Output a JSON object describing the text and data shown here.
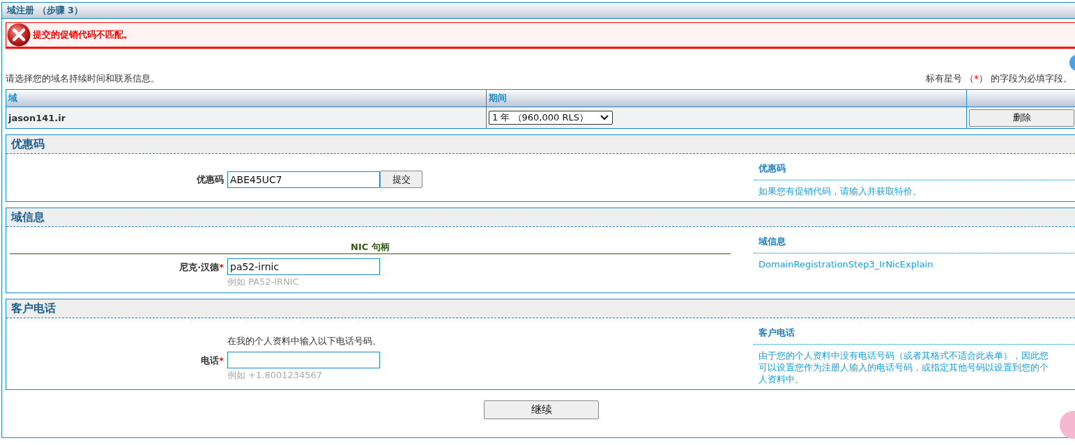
{
  "title": "域注册 （步骤 3）",
  "error": {
    "message": "提交的促销代码不匹配。"
  },
  "intro": "请选择您的域名持续时间和联系信息。",
  "required_note": {
    "before": "标有星号 （",
    "asterisk": "*",
    "after": "） 的字段为必填字段。"
  },
  "domain_table": {
    "columns": [
      "域",
      "期间"
    ],
    "rows": [
      {
        "domain": "jason141.ir",
        "period": "1 年 （960,000 RLS）",
        "action": "删除"
      }
    ]
  },
  "sections": [
    {
      "title": "优惠码",
      "items": [
        {
          "kind": "field",
          "label": "优惠码",
          "required": false,
          "value": "ABE45UC7",
          "button": "提交"
        }
      ],
      "help": {
        "title": "优惠码",
        "text": "如果您有促销代码，请输入并获取特价。"
      }
    },
    {
      "title": "域信息",
      "items": [
        {
          "kind": "subheading",
          "text": "NIC 句柄"
        },
        {
          "kind": "field",
          "label": "尼克·汉德",
          "required": true,
          "value": "pa52-irnic",
          "hint": "例如 PA52-IRNIC"
        }
      ],
      "help": {
        "title": "域信息",
        "text": "DomainRegistrationStep3_IrNicExplain"
      }
    },
    {
      "title": "客户电话",
      "items": [
        {
          "kind": "note",
          "text": "在我的个人资料中输入以下电话号码。"
        },
        {
          "kind": "field",
          "label": "电话",
          "required": true,
          "value": "",
          "hint": "例如 +1.8001234567"
        }
      ],
      "help": {
        "title": "客户电话",
        "text": "由于您的个人资料中没有电话号码（或者其格式不适合此表单），因此您可以设置您作为注册人输入的电话号码，或指定其他号码以设置到您的个人资料中。"
      }
    }
  ],
  "continue_button": "继续"
}
